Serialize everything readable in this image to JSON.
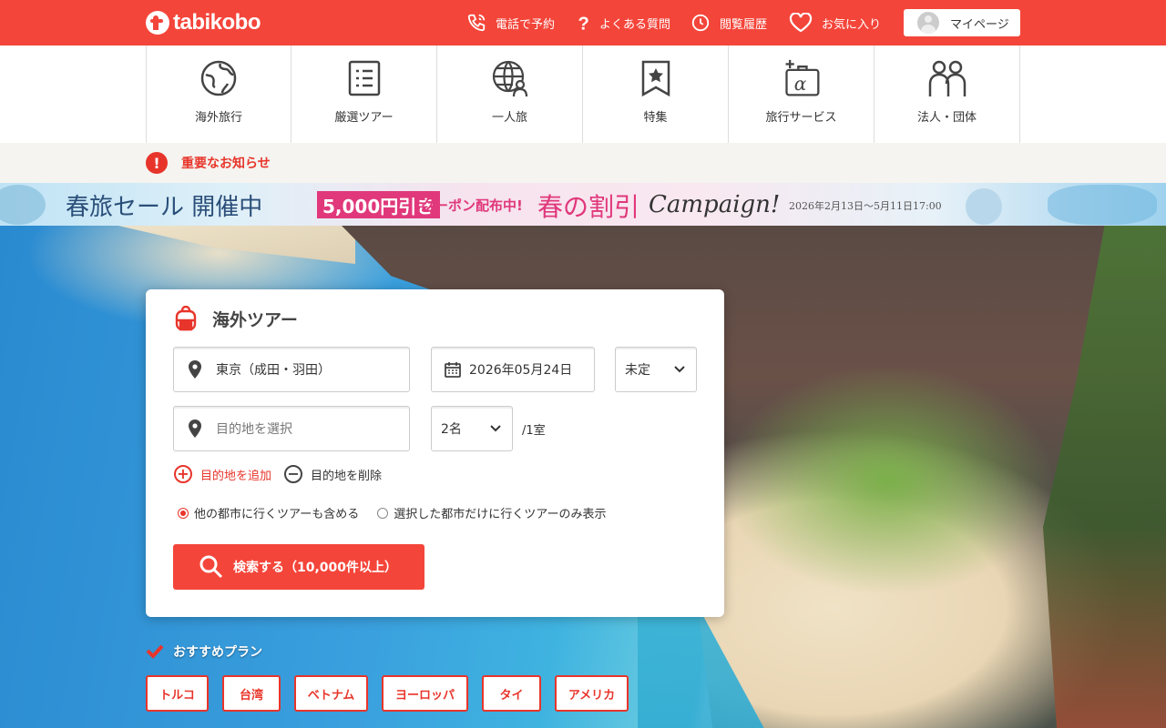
{
  "header": {
    "logo_text": "tabikobo",
    "nav": [
      {
        "label": "電話で予約",
        "icon": "phone-icon"
      },
      {
        "label": "よくある質問",
        "icon": "question-icon"
      },
      {
        "label": "閲覧履歴",
        "icon": "clock-icon"
      },
      {
        "label": "お気に入り",
        "icon": "heart-icon"
      }
    ],
    "mypage_label": "マイページ"
  },
  "categories": [
    {
      "label": "海外旅行",
      "icon": "globe-face-icon"
    },
    {
      "label": "厳選ツアー",
      "icon": "list-icon"
    },
    {
      "label": "一人旅",
      "icon": "globe-person-icon"
    },
    {
      "label": "特集",
      "icon": "star-bookmark-icon"
    },
    {
      "label": "旅行サービス",
      "icon": "suitcase-plus-icon"
    },
    {
      "label": "法人・団体",
      "icon": "group-icon"
    }
  ],
  "notice": {
    "text": "重要なお知らせ"
  },
  "banner": {
    "title": "春旅セール 開催中",
    "discount": "5,000円引き",
    "coupon": "クーポン配布中!",
    "headline": "春の割引",
    "campaign": "Campaign!",
    "period": "2026年2月13日〜5月11日17:00"
  },
  "search": {
    "title": "海外ツアー",
    "departure": "東京（成田・羽田）",
    "date": "2026年05月24日",
    "nights": "未定",
    "destination_placeholder": "目的地を選択",
    "people": "2名",
    "room_label": "/1室",
    "add_destination": "目的地を追加",
    "remove_destination": "目的地を削除",
    "option_include": "他の都市に行くツアーも含める",
    "option_only": "選択した都市だけに行くツアーのみ表示",
    "button_label": "検索する（10,000件以上）"
  },
  "recommended": {
    "title": "おすすめプラン",
    "chips": [
      "トルコ",
      "台湾",
      "ベトナム",
      "ヨーロッパ",
      "タイ",
      "アメリカ"
    ]
  },
  "colors": {
    "brand": "#f4453a",
    "accent": "#e8352b"
  }
}
